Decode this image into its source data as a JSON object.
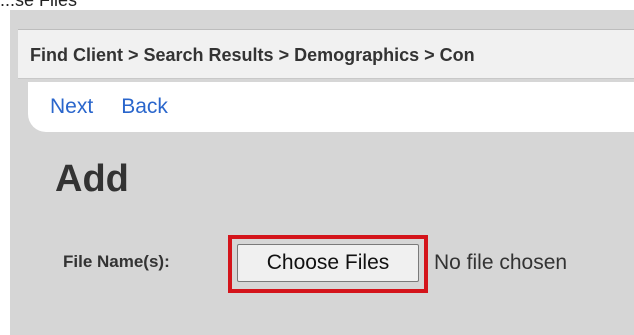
{
  "top_title": "...se Files",
  "breadcrumb": "Find Client > Search Results > Demographics > Con",
  "nav": {
    "next": "Next",
    "back": "Back"
  },
  "heading": "Add",
  "file": {
    "label": "File Name(s):",
    "button": "Choose Files",
    "status": "No file chosen"
  },
  "colors": {
    "panel_bg": "#d6d6d6",
    "link": "#2a66cc",
    "highlight": "#d4141b"
  }
}
